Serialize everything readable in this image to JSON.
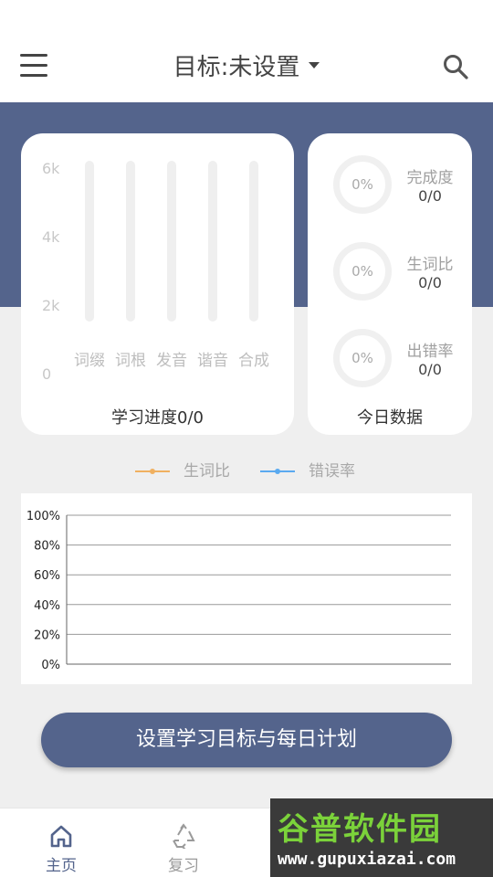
{
  "header": {
    "title": "目标:未设置"
  },
  "progress_card": {
    "y_ticks": [
      "6k",
      "4k",
      "2k",
      "0"
    ],
    "categories": [
      "词缀",
      "词根",
      "发音",
      "谐音",
      "合成"
    ],
    "caption": "学习进度0/0"
  },
  "today_card": {
    "caption": "今日数据",
    "stats": [
      {
        "label": "完成度",
        "percent": "0%",
        "value": "0/0"
      },
      {
        "label": "生词比",
        "percent": "0%",
        "value": "0/0"
      },
      {
        "label": "出错率",
        "percent": "0%",
        "value": "0/0"
      }
    ]
  },
  "legend": {
    "items": [
      {
        "name": "生词比",
        "color": "#f0b060"
      },
      {
        "name": "错误率",
        "color": "#5aaaf0"
      }
    ]
  },
  "chart_data": {
    "type": "line",
    "y_ticks": [
      "100%",
      "80%",
      "60%",
      "40%",
      "20%",
      "0%"
    ],
    "ylim": [
      0,
      100
    ],
    "series": [
      {
        "name": "生词比",
        "values": []
      },
      {
        "name": "错误率",
        "values": []
      }
    ],
    "legend_position": "top-center",
    "grid": true
  },
  "cta": {
    "label": "设置学习目标与每日计划"
  },
  "bottom_nav": {
    "items": [
      {
        "label": "主页",
        "icon": "home-icon",
        "active": true
      },
      {
        "label": "复习",
        "icon": "recycle-icon",
        "active": false
      }
    ],
    "active_color": "#54648c",
    "inactive_color": "#9a9a9a"
  },
  "watermark": {
    "top": "谷普软件园",
    "bottom": "www.gupuxiazai.com"
  }
}
